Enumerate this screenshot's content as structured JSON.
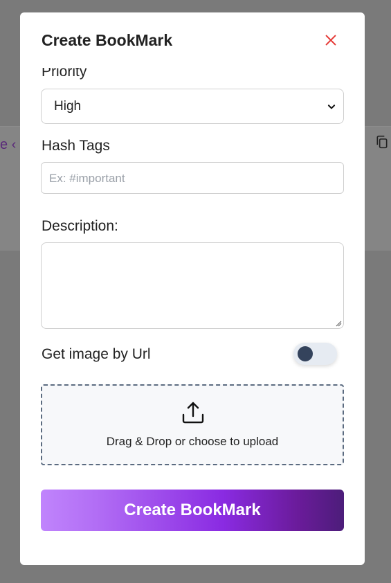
{
  "background": {
    "link_fragment": "e ‹",
    "copy_icon": "copy-icon"
  },
  "modal": {
    "title": "Create BookMark",
    "close_icon": "close-icon",
    "priority": {
      "label": "Priority",
      "selected": "High"
    },
    "hash_tags": {
      "label": "Hash Tags",
      "placeholder": "Ex: #important"
    },
    "description": {
      "label": "Description:",
      "value": ""
    },
    "image_by_url": {
      "label": "Get image by Url",
      "enabled": false
    },
    "upload": {
      "icon": "upload-icon",
      "text": "Drag & Drop or choose to upload"
    },
    "submit_label": "Create BookMark"
  },
  "colors": {
    "accent_start": "#c084fc",
    "accent_end": "#4c1d7a",
    "close": "#e53935",
    "toggle_knob": "#34435c"
  }
}
